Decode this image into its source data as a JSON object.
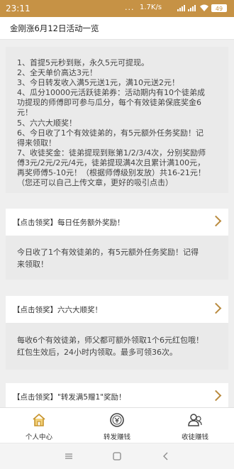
{
  "status_bar": {
    "time": "23:11",
    "dots": "...",
    "network_speed": "1.7K/s",
    "battery": "49"
  },
  "header": {
    "title": "金刚涨6月12日活动一览"
  },
  "notice": {
    "lines": [
      "1、首提5元秒到账，永久5元可提现。",
      "2、全天单价高达3元！",
      "3、今日转发收入满5元送1元，满10元送2元！",
      "4、瓜分10000元活跃徒弟券：活动期内有10个徒弟成",
      "功提现的师傅即可参与瓜分，每个有效徒弟保底奖金6",
      "元！",
      "5、六六大顺奖！",
      "6、今日收了1个有效徒弟的，有5元额外任务奖励！记",
      "得来领取！",
      "7、收徒奖金：徒弟提现到账第1/2/3/4次，分别奖励师",
      "傅3元/2元/2元/4元，徒弟提现满4次且累计满100元，",
      "再奖师傅5-10元！（根据师傅级别发放）共16-21元！",
      "（您还可以自己上传文章，更好的吸引点击）"
    ]
  },
  "cards": [
    {
      "title": "【点击领奖】每日任务额外奖励！",
      "body": [
        "今日收了1个有效徒弟的，有5元额外任务奖励！记得",
        "来领取！"
      ]
    },
    {
      "title": "【点击领奖】六六大顺奖！",
      "body": [
        "每收6个有效徒弟，师父都可额外领取1个6元红包哦！",
        "红包生效后，24小时内领取。最多可领36次。"
      ]
    },
    {
      "title": "【点击领奖】\"转发满5赠1\"奖励！",
      "body": []
    }
  ],
  "tabbar": [
    {
      "label": "个人中心",
      "icon": "home-icon"
    },
    {
      "label": "转发赚钱",
      "icon": "coin-icon"
    },
    {
      "label": "收徒赚钱",
      "icon": "people-icon"
    }
  ],
  "colors": {
    "accent": "#c69245",
    "chevron": "#b98a3e",
    "tab_icon": "#c8952f"
  }
}
